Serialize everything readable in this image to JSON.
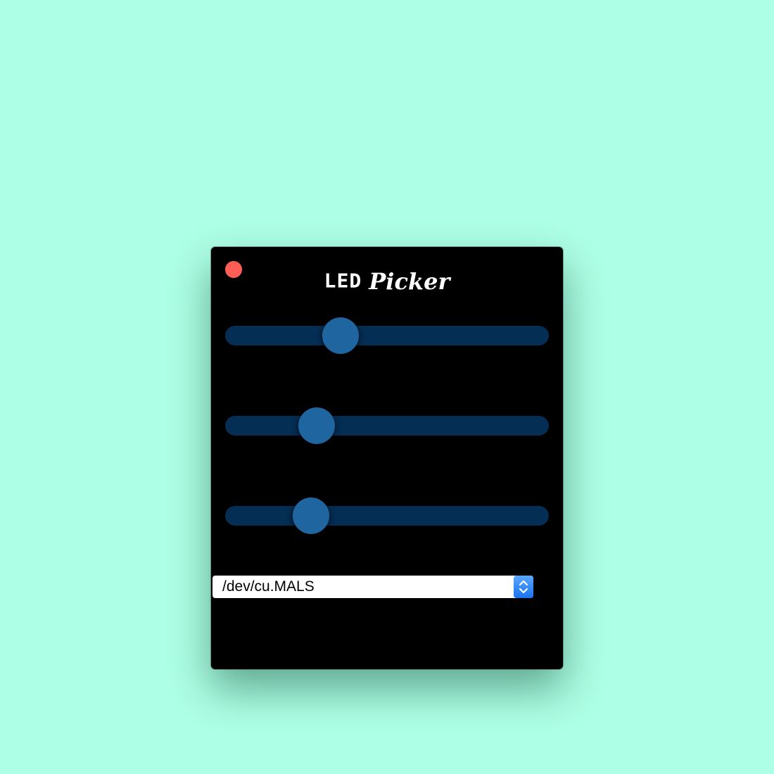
{
  "window": {
    "title_part1": "LED",
    "title_part2": "Picker"
  },
  "controls": {
    "close_icon": "close-icon",
    "sliders": [
      {
        "name": "slider-1",
        "value": 0.357
      },
      {
        "name": "slider-2",
        "value": 0.283
      },
      {
        "name": "slider-3",
        "value": 0.265
      }
    ]
  },
  "port_select": {
    "value": "/dev/cu.MALS",
    "icon": "chevron-up-down-icon"
  },
  "colors": {
    "background": "#adffe5",
    "window": "#000000",
    "close_button": "#fe5e56",
    "slider_track": "#052e55",
    "slider_thumb": "#1f65a0",
    "stepper": "#1a72ef"
  }
}
